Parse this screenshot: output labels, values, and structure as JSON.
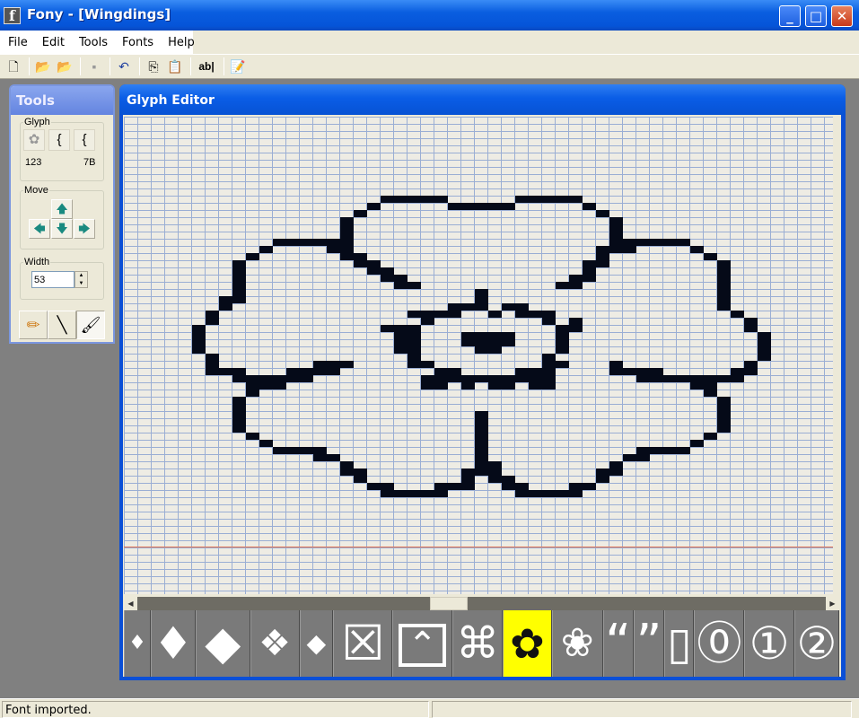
{
  "window": {
    "title": "Fony - [Wingdings]",
    "app_icon": "f",
    "controls": {
      "minimize": "_",
      "maximize": "□",
      "close": "✕"
    }
  },
  "menu": [
    "File",
    "Edit",
    "Tools",
    "Fonts",
    "Help"
  ],
  "toolbar": [
    {
      "icon": "new-file-icon",
      "glyph": "🗋"
    },
    {
      "sep": true
    },
    {
      "icon": "open-folder-icon",
      "glyph": "📂"
    },
    {
      "icon": "import-folder-icon",
      "glyph": "📂"
    },
    {
      "sep": true
    },
    {
      "icon": "save-icon",
      "glyph": "▪"
    },
    {
      "sep": true
    },
    {
      "icon": "undo-icon",
      "glyph": "↶"
    },
    {
      "sep": true
    },
    {
      "icon": "copy-icon",
      "glyph": "⎘"
    },
    {
      "icon": "paste-icon",
      "glyph": "📋"
    },
    {
      "sep": true
    },
    {
      "icon": "text-icon",
      "glyph": "ab|"
    },
    {
      "sep": true
    },
    {
      "icon": "properties-icon",
      "glyph": "📝"
    }
  ],
  "tools": {
    "title": "Tools",
    "glyph": {
      "label": "Glyph",
      "preview": "✿",
      "prev": "{",
      "next": "{",
      "dec": "123",
      "hex": "7B"
    },
    "move": {
      "label": "Move",
      "up": "🡅",
      "left": "🡄",
      "down": "🡇",
      "right": "🡆"
    },
    "width": {
      "label": "Width",
      "value": "53"
    },
    "draw_tools": [
      {
        "name": "pencil-icon",
        "glyph": "✏"
      },
      {
        "name": "line-icon",
        "glyph": "╲"
      },
      {
        "name": "fill-icon",
        "glyph": "🖌"
      }
    ]
  },
  "editor": {
    "title": "Glyph Editor",
    "columns": 53,
    "baseline_row": 60,
    "glyph_rows": {
      "11": "19-23,29-33",
      "12": "18,24-28,34",
      "13": "17,35",
      "14": "16,36",
      "15": "16,36",
      "16": "16,36",
      "17": "11-16,36-41",
      "18": "10,15-16,35-37,42",
      "19": "9,16-17,35,43",
      "20": "8,17-18,34-35,44",
      "21": "8,18-19,34,44",
      "22": "8,19-20,33-34,44",
      "23": "8,20-21,32-33,44",
      "24": "8,26,44",
      "25": "7-8,26,44",
      "26": "7,24-26,28-29,44",
      "27": "6,21-24,27,29-31,45",
      "28": "6,22,31,33,46",
      "29": "5,19-21,32-33,46",
      "30": "5,20-21,25-28,32,47",
      "31": "5,20-21,25-28,32,47",
      "32": "5,20-21,26-27,32,47",
      "33": "6,21,31,47",
      "34": "6,14-16,21-22,31-32,36,46",
      "35": "6-8,12-15,23-24,29-31,36-39,45-46",
      "36": "8-13,22-31,38-45",
      "37": "9-11,22-23,25,27-28,30-31,42-43",
      "38": "9,43",
      "39": "8,44",
      "40": "8,44",
      "41": "8,26,44",
      "42": "8,26,44",
      "43": "8,26,44",
      "44": "9,26,43",
      "45": "10,26,42",
      "46": "11-14,26,38-41",
      "47": "14-15,26,37-38",
      "48": "16,26-27,36",
      "49": "16-17,25-27,35-36",
      "50": "17,25,27-28,35",
      "51": "18-19,23-25,28-29,33-34",
      "52": "19-23,29-33"
    },
    "scroll_position": 0.45
  },
  "glyph_strip": [
    {
      "char": "♦",
      "size": 22,
      "w": 30
    },
    {
      "char": "♦",
      "size": 50,
      "w": 50
    },
    {
      "char": "◆",
      "size": 52,
      "w": 61
    },
    {
      "char": "❖",
      "size": 40,
      "w": 55
    },
    {
      "char": "◆",
      "size": 28,
      "w": 38
    },
    {
      "char": "☒",
      "size": 54,
      "w": 66
    },
    {
      "char": "⌃",
      "size": 40,
      "w": 67,
      "boxed": true
    },
    {
      "char": "⌘",
      "size": 48,
      "w": 56
    },
    {
      "char": "✿",
      "size": 46,
      "w": 55,
      "selected": true
    },
    {
      "char": "❀",
      "size": 44,
      "w": 57
    },
    {
      "char": "“",
      "size": 56,
      "w": 34
    },
    {
      "char": "”",
      "size": 56,
      "w": 35
    },
    {
      "char": "▯",
      "size": 50,
      "w": 33
    },
    {
      "char": "⓪",
      "size": 50,
      "w": 56
    },
    {
      "char": "①",
      "size": 50,
      "w": 56
    },
    {
      "char": "②",
      "size": 50,
      "w": 50
    }
  ],
  "colors": {
    "selected_glyph": "#ffff00",
    "pixel": "#050a18",
    "baseline": "#e07050"
  },
  "status": {
    "message": "Font imported.",
    "secondary": ""
  }
}
